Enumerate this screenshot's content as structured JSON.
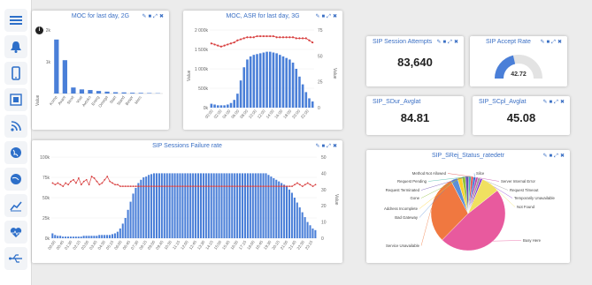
{
  "sidebar": {
    "items": [
      "menu-icon",
      "bell-icon",
      "mobile-icon",
      "resize-icon",
      "rss-icon",
      "globe-icon",
      "globe-icon",
      "line-chart-icon",
      "heartbeat-icon",
      "usb-icon"
    ]
  },
  "controls": {
    "edit": "✎",
    "lock": "■",
    "expand": "⤢",
    "close": "✖"
  },
  "panels": {
    "moc2g": {
      "title": "MOC for last day, 2G",
      "info": "i",
      "ylabel": "Value",
      "ytick_top": "2k",
      "ytick_mid": "1k"
    },
    "moc3g": {
      "title": "MOC, ASR for last day, 3G",
      "ylabel": "Value",
      "ylabel_right": "Value"
    },
    "sip_attempts": {
      "title": "SIP Session Attempts",
      "value": "83,640"
    },
    "sip_accept": {
      "title": "SIP Accept Rate",
      "value": "42.72"
    },
    "sip_sdur": {
      "title": "SIP_SDur_Avglat",
      "value": "84.81"
    },
    "sip_scpl": {
      "title": "SIP_SCpl_Avglat",
      "value": "45.08"
    },
    "sip_fail": {
      "title": "SIP Sessions Failure rate",
      "ylabel_right": "Value"
    },
    "sip_srej": {
      "title": "SIP_SRej_Status_ratedetr"
    }
  },
  "chart_data": [
    {
      "type": "bar",
      "title": "MOC for last day, 2G",
      "ylabel": "Value",
      "yticks": [
        "2k",
        "1k"
      ],
      "categories": [
        "Kompaniya",
        "Avantage",
        "Rassvet",
        "Vostok",
        "Avtokomplekt",
        "Stroitel",
        "Energia",
        "Svetlana",
        "Omega",
        "Start",
        "Standart",
        "Bespredel",
        "Mercury"
      ],
      "values": [
        1700,
        1050,
        190,
        130,
        110,
        80,
        60,
        40,
        35,
        25,
        20,
        15,
        10
      ],
      "xtick_labels_visible": [
        "Komp",
        "Avant",
        "Stroit",
        "Vost",
        "Avtoko",
        "Energ",
        "Omega",
        "Start",
        "Stand",
        "Bespr",
        "Merc"
      ]
    },
    {
      "type": "bar",
      "title": "MOC, ASR for last day, 3G",
      "ylabel": "Value",
      "ylabel_right": "Value",
      "yticks_left": [
        "2 000k",
        "1 500k",
        "1 000k",
        "500k",
        "0k"
      ],
      "yticks_right": [
        "75",
        "50",
        "25",
        "0"
      ],
      "xticks": [
        "00:00",
        "02:00",
        "04:00",
        "06:00",
        "08:00",
        "10:00",
        "12:00",
        "14:00",
        "16:00",
        "18:00",
        "20:00",
        "22:00"
      ],
      "bars": [
        5,
        4,
        3,
        3,
        3,
        4,
        6,
        10,
        18,
        35,
        52,
        62,
        66,
        68,
        69,
        70,
        71,
        72,
        72,
        71,
        70,
        68,
        66,
        64,
        62,
        58,
        50,
        40,
        30,
        20,
        12,
        8
      ],
      "line_series": [
        62,
        61,
        60,
        59,
        60,
        61,
        62,
        63,
        65,
        66,
        67,
        68,
        68,
        68,
        69,
        69,
        69,
        69,
        69,
        69,
        68,
        68,
        68,
        68,
        68,
        68,
        67,
        67,
        67,
        67,
        65,
        63
      ]
    },
    {
      "type": "bar",
      "title": "SIP Sessions Failure rate",
      "yticks_left": [
        "100k",
        "75k",
        "50k",
        "25k",
        "0k"
      ],
      "yticks_right": [
        "50",
        "40",
        "30",
        "20",
        "10",
        "0"
      ],
      "ylabel_right": "Value",
      "xticks": [
        "00:00",
        "00:45",
        "01:30",
        "02:15",
        "03:00",
        "03:45",
        "04:30",
        "05:15",
        "06:00",
        "06:45",
        "07:30",
        "08:15",
        "09:00",
        "09:45",
        "10:30",
        "11:15",
        "12:00",
        "12:45",
        "13:30",
        "14:15",
        "15:00",
        "15:45",
        "16:30",
        "17:15",
        "18:00",
        "18:45",
        "19:30",
        "20:15",
        "21:00",
        "21:45",
        "22:30",
        "23:15"
      ],
      "bars": [
        6,
        4,
        3,
        3,
        2,
        2,
        2,
        2,
        2,
        2,
        2,
        2,
        3,
        3,
        3,
        3,
        3,
        3,
        4,
        4,
        4,
        4,
        4,
        5,
        6,
        8,
        12,
        18,
        25,
        35,
        45,
        55,
        62,
        68,
        72,
        75,
        76,
        78,
        79,
        80,
        80,
        80,
        80,
        80,
        80,
        80,
        80,
        80,
        80,
        80,
        80,
        80,
        80,
        80,
        80,
        80,
        80,
        80,
        80,
        80,
        80,
        80,
        80,
        80,
        80,
        80,
        80,
        80,
        80,
        80,
        80,
        80,
        80,
        80,
        80,
        80,
        80,
        80,
        80,
        80,
        80,
        80,
        80,
        78,
        76,
        74,
        72,
        70,
        68,
        66,
        64,
        60,
        56,
        50,
        44,
        38,
        32,
        26,
        20,
        16,
        12,
        10
      ],
      "line_series": [
        34,
        33,
        34,
        33,
        32,
        34,
        33,
        35,
        36,
        34,
        37,
        33,
        35,
        36,
        33,
        38,
        37,
        35,
        33,
        34,
        36,
        38,
        35,
        34,
        33,
        33,
        32,
        32,
        32,
        32,
        32,
        32,
        32,
        32,
        32,
        32,
        32,
        32,
        32,
        32,
        32,
        32,
        32,
        32,
        32,
        32,
        32,
        32,
        32,
        32,
        32,
        32,
        32,
        32,
        32,
        32,
        32,
        32,
        32,
        32,
        32,
        32,
        32,
        32,
        32,
        32,
        32,
        32,
        32,
        32,
        32,
        32,
        32,
        32,
        32,
        32,
        32,
        32,
        32,
        32,
        32,
        32,
        32,
        32,
        32,
        32,
        32,
        32,
        32,
        32,
        32,
        32,
        32,
        33,
        34,
        33,
        32,
        33,
        34,
        33,
        32,
        33
      ]
    },
    {
      "type": "pie",
      "title": "SIP_SRej_Status_ratedetr",
      "slices": [
        {
          "label": "Busy Here",
          "value": 48,
          "color": "#e85a9e"
        },
        {
          "label": "Service Unavailable",
          "value": 30,
          "color": "#f07840"
        },
        {
          "label": "Bad Gateway",
          "value": 3,
          "color": "#5a8fd8"
        },
        {
          "label": "Address Incomplete",
          "value": 2,
          "color": "#ffd12b"
        },
        {
          "label": "Gone",
          "value": 1.5,
          "color": "#8fc23a"
        },
        {
          "label": "Request Terminated",
          "value": 1.5,
          "color": "#6b4fb2"
        },
        {
          "label": "Request Pending",
          "value": 1,
          "color": "#3fb8a8"
        },
        {
          "label": "Method Not Allowed",
          "value": 1,
          "color": "#e04848"
        },
        {
          "label": "Silce",
          "value": 1,
          "color": "#2e6ed4"
        },
        {
          "label": "Server Internal Error",
          "value": 1,
          "color": "#c048a8"
        },
        {
          "label": "Request Timeout",
          "value": 1,
          "color": "#9a9a9a"
        },
        {
          "label": "Temporarily Unavailable",
          "value": 1,
          "color": "#8a3fd4"
        },
        {
          "label": "Not Found",
          "value": 8,
          "color": "#f0e060"
        }
      ]
    }
  ],
  "colors": {
    "bar": "#4a7fd8",
    "line": "#d84040",
    "accent": "#3a6fc4",
    "sidebar_icon": "#2d6fc9"
  }
}
